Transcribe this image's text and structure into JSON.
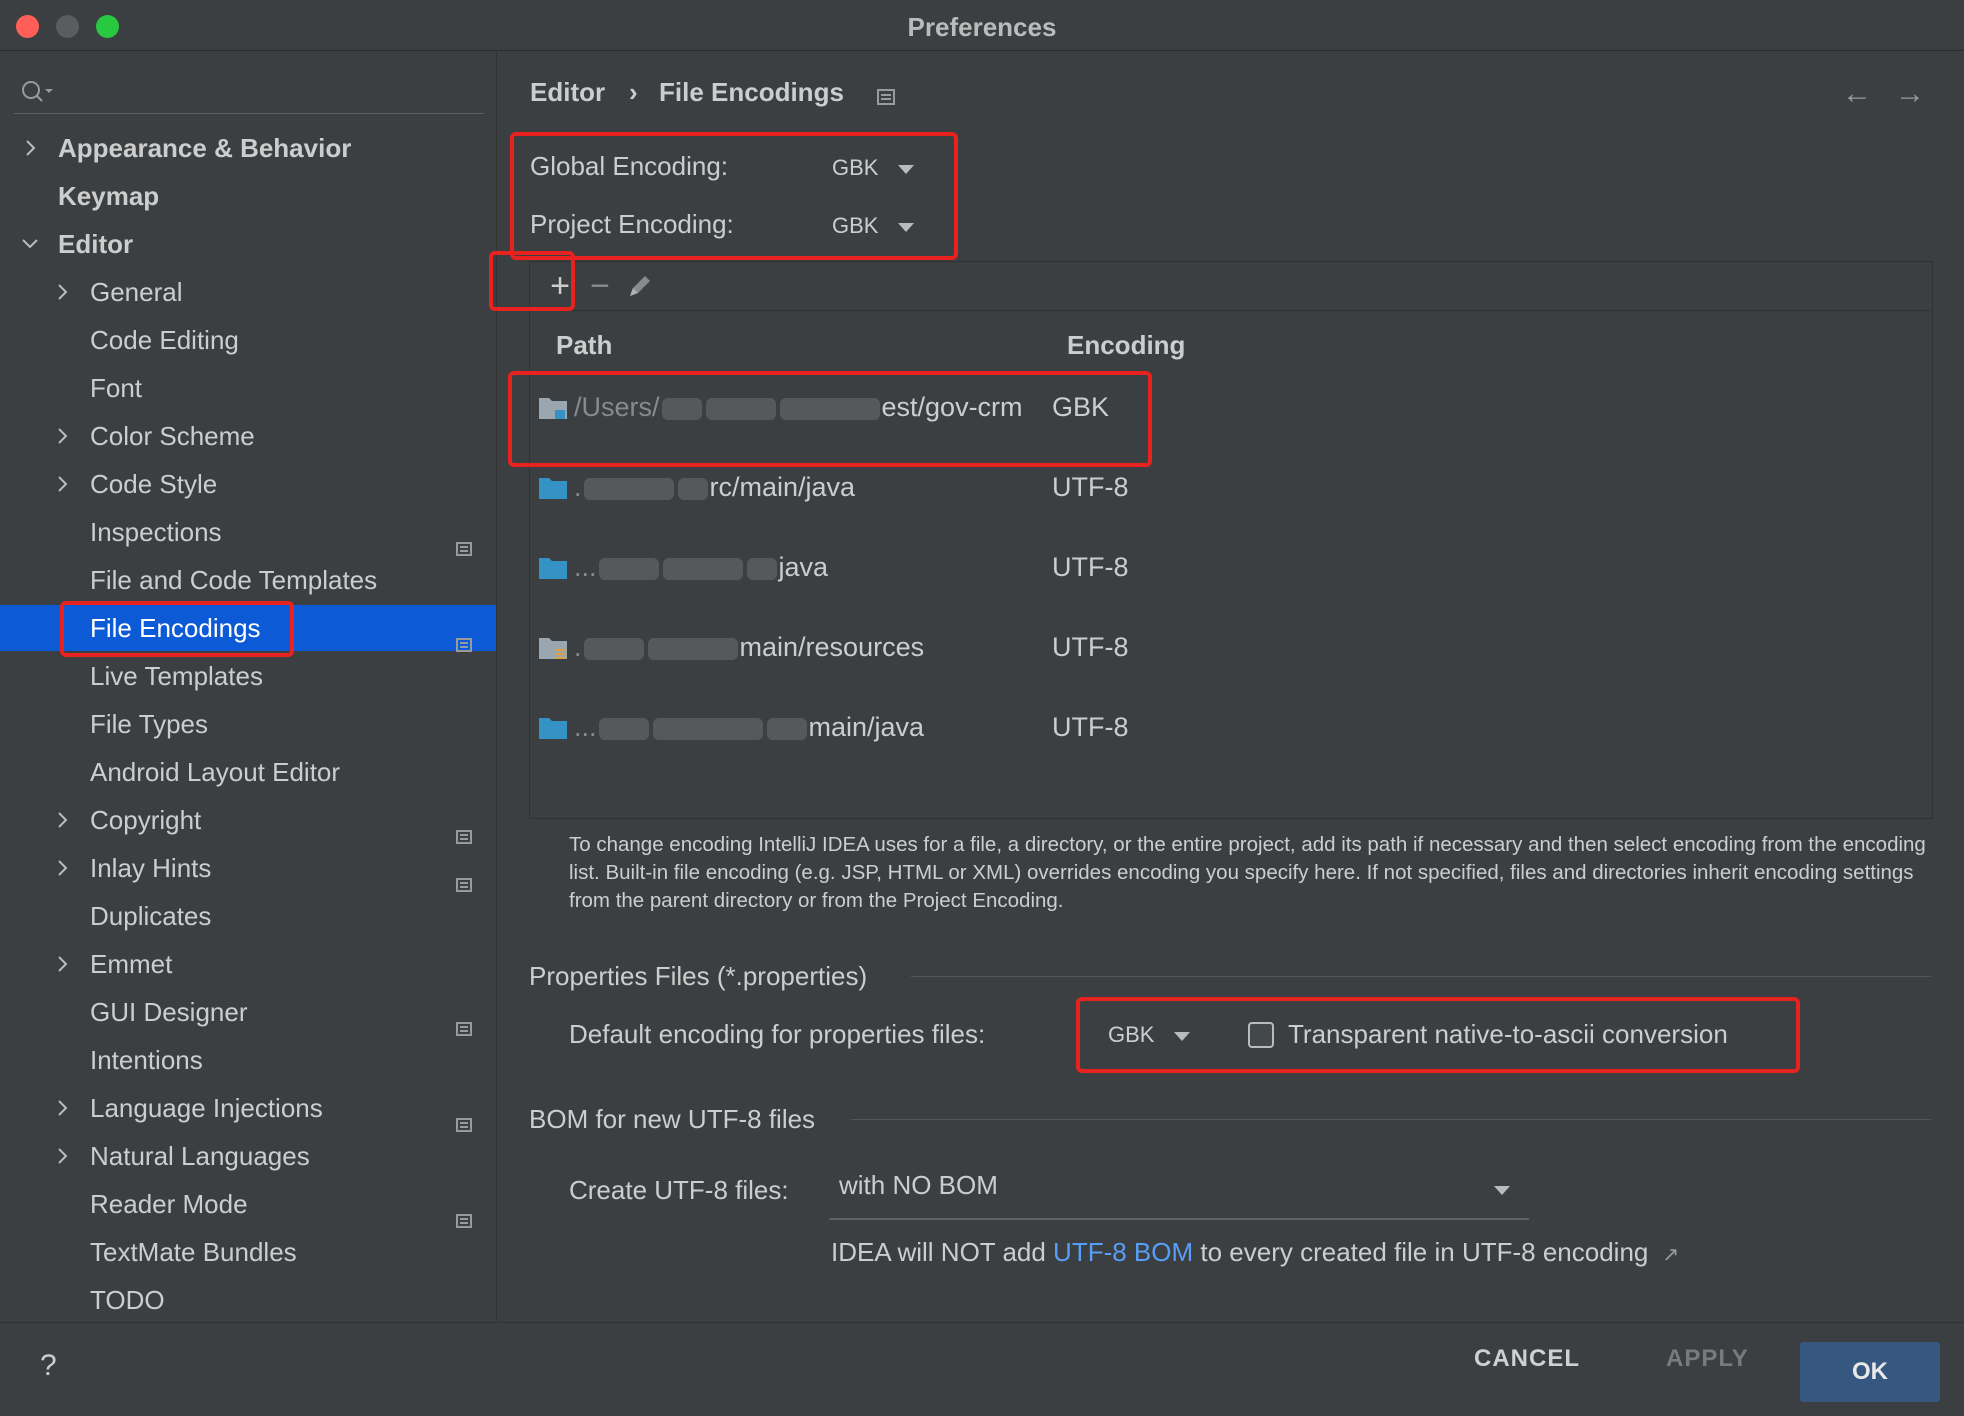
{
  "window": {
    "title": "Preferences"
  },
  "sidebar": {
    "search_placeholder": "",
    "items": [
      {
        "label": "Appearance & Behavior",
        "level": 0,
        "chevron": "right",
        "bold": true,
        "project": false
      },
      {
        "label": "Keymap",
        "level": 0,
        "chevron": "none",
        "bold": true,
        "project": false
      },
      {
        "label": "Editor",
        "level": 0,
        "chevron": "down",
        "bold": true,
        "project": false
      },
      {
        "label": "General",
        "level": 1,
        "chevron": "right",
        "bold": false,
        "project": false
      },
      {
        "label": "Code Editing",
        "level": 1,
        "chevron": "none",
        "bold": false,
        "project": false
      },
      {
        "label": "Font",
        "level": 1,
        "chevron": "none",
        "bold": false,
        "project": false
      },
      {
        "label": "Color Scheme",
        "level": 1,
        "chevron": "right",
        "bold": false,
        "project": false
      },
      {
        "label": "Code Style",
        "level": 1,
        "chevron": "right",
        "bold": false,
        "project": false
      },
      {
        "label": "Inspections",
        "level": 1,
        "chevron": "none",
        "bold": false,
        "project": true
      },
      {
        "label": "File and Code Templates",
        "level": 1,
        "chevron": "none",
        "bold": false,
        "project": false
      },
      {
        "label": "File Encodings",
        "level": 1,
        "chevron": "none",
        "bold": false,
        "project": true,
        "selected": true
      },
      {
        "label": "Live Templates",
        "level": 1,
        "chevron": "none",
        "bold": false,
        "project": false
      },
      {
        "label": "File Types",
        "level": 1,
        "chevron": "none",
        "bold": false,
        "project": false
      },
      {
        "label": "Android Layout Editor",
        "level": 1,
        "chevron": "none",
        "bold": false,
        "project": false
      },
      {
        "label": "Copyright",
        "level": 1,
        "chevron": "right",
        "bold": false,
        "project": true
      },
      {
        "label": "Inlay Hints",
        "level": 1,
        "chevron": "right",
        "bold": false,
        "project": true
      },
      {
        "label": "Duplicates",
        "level": 1,
        "chevron": "none",
        "bold": false,
        "project": false
      },
      {
        "label": "Emmet",
        "level": 1,
        "chevron": "right",
        "bold": false,
        "project": false
      },
      {
        "label": "GUI Designer",
        "level": 1,
        "chevron": "none",
        "bold": false,
        "project": true
      },
      {
        "label": "Intentions",
        "level": 1,
        "chevron": "none",
        "bold": false,
        "project": false
      },
      {
        "label": "Language Injections",
        "level": 1,
        "chevron": "right",
        "bold": false,
        "project": true
      },
      {
        "label": "Natural Languages",
        "level": 1,
        "chevron": "right",
        "bold": false,
        "project": false
      },
      {
        "label": "Reader Mode",
        "level": 1,
        "chevron": "none",
        "bold": false,
        "project": true
      },
      {
        "label": "TextMate Bundles",
        "level": 1,
        "chevron": "none",
        "bold": false,
        "project": false
      },
      {
        "label": "TODO",
        "level": 1,
        "chevron": "none",
        "bold": false,
        "project": false
      }
    ]
  },
  "breadcrumb": {
    "parent": "Editor",
    "separator": "›",
    "current": "File Encodings"
  },
  "nav": {
    "back": "←",
    "forward": "→"
  },
  "encoding": {
    "global_label": "Global Encoding:",
    "global_value": "GBK",
    "project_label": "Project Encoding:",
    "project_value": "GBK"
  },
  "toolbar": {
    "add": "+",
    "remove": "−"
  },
  "table": {
    "headers": {
      "path": "Path",
      "encoding": "Encoding"
    },
    "rows": [
      {
        "path_prefix": "/Users/",
        "path_suffix": "est/gov-crm",
        "encoding": "GBK",
        "icon": "module-folder-icon"
      },
      {
        "path_prefix": ".",
        "path_suffix": "rc/main/java",
        "encoding": "UTF-8",
        "icon": "source-folder-icon"
      },
      {
        "path_prefix": "...",
        "path_suffix": "java",
        "encoding": "UTF-8",
        "icon": "source-folder-icon"
      },
      {
        "path_prefix": ".",
        "path_suffix": "main/resources",
        "encoding": "UTF-8",
        "icon": "resources-folder-icon"
      },
      {
        "path_prefix": "...",
        "path_suffix": "main/java",
        "encoding": "UTF-8",
        "icon": "source-folder-icon"
      }
    ]
  },
  "help_text": "To change encoding IntelliJ IDEA uses for a file, a directory, or the entire project, add its path if necessary and then select encoding from the encoding list. Built-in file encoding (e.g. JSP, HTML or XML) overrides encoding you specify here. If not specified, files and directories inherit encoding settings from the parent directory or from the Project Encoding.",
  "properties": {
    "section_title": "Properties Files (*.properties)",
    "default_label": "Default encoding for properties files:",
    "default_value": "GBK",
    "transparent_label": "Transparent native-to-ascii conversion",
    "transparent_checked": false
  },
  "bom": {
    "section_title": "BOM for new UTF-8 files",
    "create_label": "Create UTF-8 files:",
    "create_value": "with NO BOM",
    "note_before": "IDEA will NOT add ",
    "note_link": "UTF-8 BOM",
    "note_after": " to every created file in UTF-8 encoding",
    "note_arrow": "↗"
  },
  "footer": {
    "help": "?",
    "cancel": "CANCEL",
    "apply": "APPLY",
    "ok": "OK"
  },
  "colors": {
    "selection": "#0d5ad6",
    "highlight": "#e8231f",
    "link": "#589df6",
    "ok_button": "#365880"
  }
}
